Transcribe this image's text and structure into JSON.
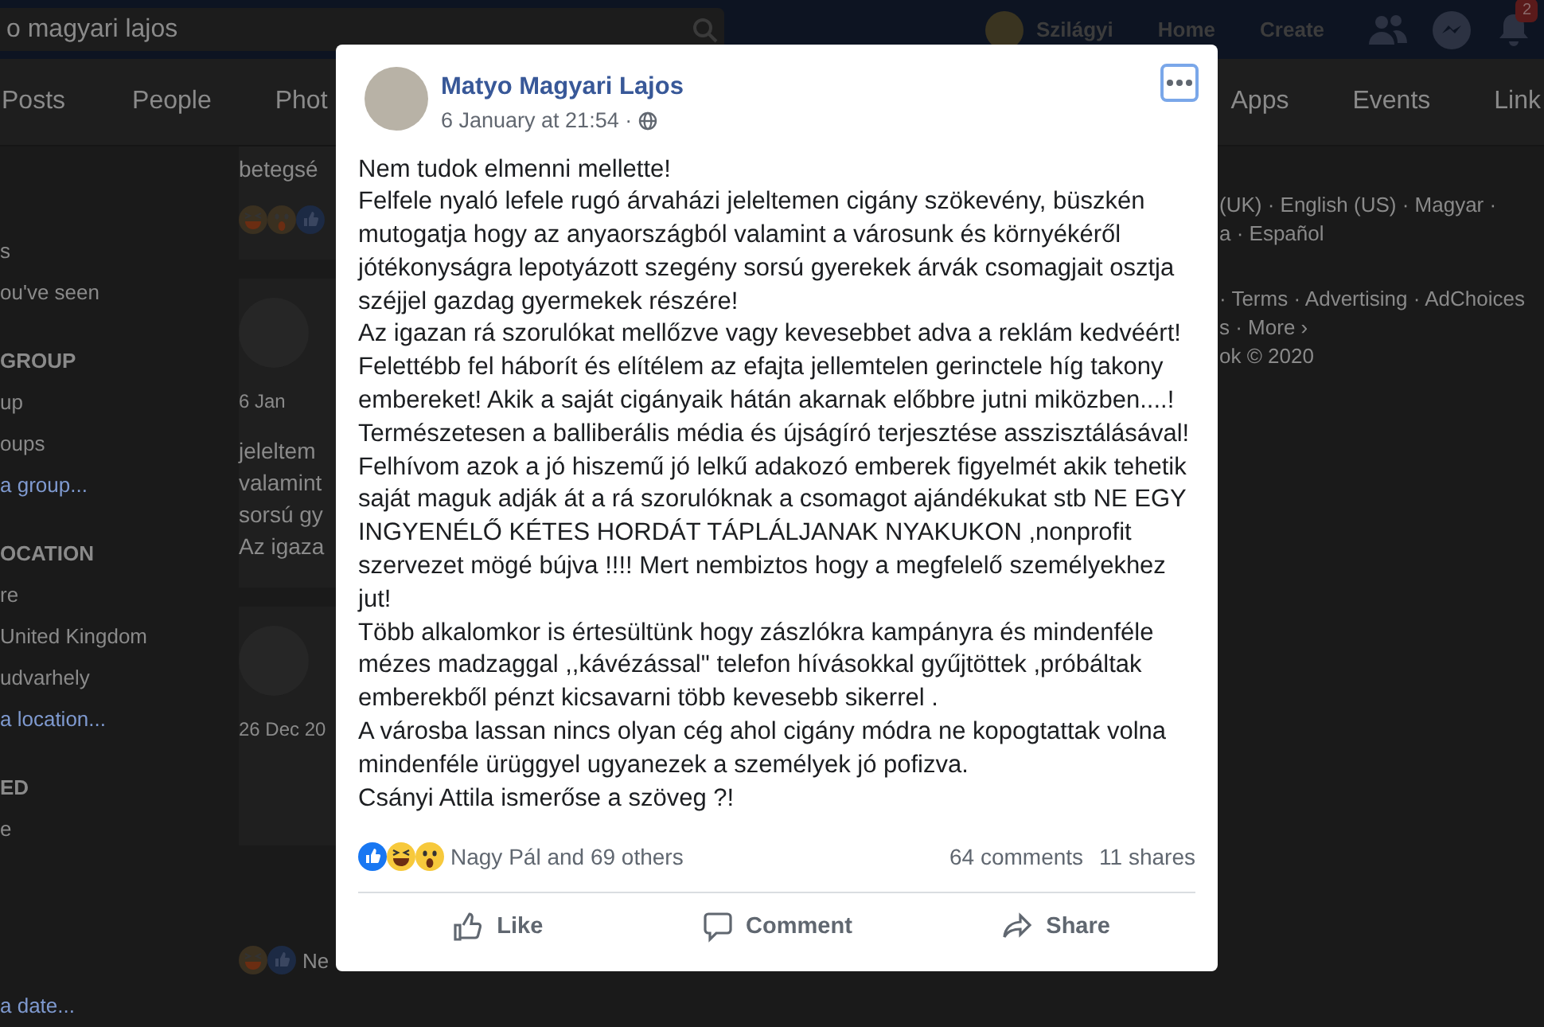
{
  "top_bar": {
    "search": {
      "value": "o magyari lajos"
    },
    "profile_name": "Szilágyi",
    "nav": [
      "Home",
      "Create"
    ],
    "notification_count": "2"
  },
  "tabs": [
    {
      "label": "Posts",
      "selected": false
    },
    {
      "label": "People",
      "selected": false
    },
    {
      "label": "Phot",
      "selected": false
    },
    {
      "label": "Apps",
      "selected": false
    },
    {
      "label": "Events",
      "selected": false
    },
    {
      "label": "Link",
      "selected": false
    }
  ],
  "sidebar": {
    "sections": [
      {
        "items": [
          {
            "label": "s",
            "kind": "item"
          },
          {
            "label": "ou've seen",
            "kind": "item"
          }
        ]
      },
      {
        "heading": "GROUP",
        "items": [
          {
            "label": "up",
            "kind": "item"
          },
          {
            "label": "oups",
            "kind": "item"
          },
          {
            "label": "a group...",
            "kind": "link"
          }
        ]
      },
      {
        "heading": "OCATION",
        "items": [
          {
            "label": "re",
            "kind": "item"
          },
          {
            "label": "United Kingdom",
            "kind": "item"
          },
          {
            "label": "udvarhely",
            "kind": "item"
          },
          {
            "label": "a location...",
            "kind": "link"
          }
        ]
      },
      {
        "heading": "ED",
        "items": [
          {
            "label": "e",
            "kind": "item"
          }
        ]
      }
    ],
    "footer_link": "a date..."
  },
  "feed": {
    "top_text": "betegsé",
    "posts": [
      {
        "date": "6 Jan",
        "lines": [
          "jeleltem",
          "valamint",
          "sorsú gy",
          "Az igaza"
        ]
      },
      {
        "date": "26 Dec 20"
      }
    ],
    "bottom_text": "Ne"
  },
  "right_column": {
    "languages": [
      "(UK) · English (US) · Magyar ·",
      "a · Español"
    ],
    "footer": [
      "· Terms · Advertising · AdChoices",
      "s · More ›",
      "ok © 2020"
    ]
  },
  "post": {
    "author": "Matyo Magyari Lajos",
    "time": "6 January at 21:54 ·",
    "paragraphs": [
      "Nem tudok elmenni mellette!",
      "Felfele nyaló lefele rugó árvaházi jeleltemen cigány szökevény, büszkén mutogatja hogy az anyaországból valamint a városunk és környékéről jótékonyságra lepotyázott szegény sorsú gyerekek árvák csomagjait osztja széjjel gazdag gyermekek részére!",
      "Az igazan rá szorulókat mellőzve vagy kevesebbet adva a reklám kedvéért!",
      "Felettébb fel háborít és elítélem az efajta jellemtelen gerinctele híg takony embereket! Akik a saját cigányaik hátán akarnak előbbre jutni miközben....!",
      "Természetesen a balliberális média és újságíró terjesztése asszisztálásával!",
      "Felhívom azok a jó hiszemű jó lelkű adakozó emberek figyelmét akik tehetik saját maguk adják át a rá szorulóknak a csomagot ajándékukat stb NE EGY INGYENÉLŐ KÉTES HORDÁT TÁPLÁLJANAK NYAKUKON ,nonprofit szervezet mögé bújva !!!! Mert nembiztos hogy a megfelelő személyekhez jut!",
      "Több alkalomkor is értesültünk hogy zászlókra kampányra és mindenféle mézes madzaggal ,,kávézással\" telefon hívásokkal gyűjtöttek ,próbáltak emberekből pénzt kicsavarni több kevesebb sikerrel .",
      "A városba lassan nincs olyan cég ahol cigány módra ne kopogtattak volna mindenféle ürüggyel ugyanezek a személyek jó pofizva.",
      "Csányi Attila ismerőse a szöveg ?!"
    ],
    "reactions": [
      {
        "kind": "like"
      },
      {
        "kind": "haha"
      },
      {
        "kind": "wow"
      }
    ],
    "reacted_by": "Nagy Pál and 69 others",
    "comments": "64 comments",
    "shares": "11 shares",
    "actions": [
      {
        "kind": "like",
        "label": "Like"
      },
      {
        "kind": "comment",
        "label": "Comment"
      },
      {
        "kind": "share",
        "label": "Share"
      }
    ]
  }
}
